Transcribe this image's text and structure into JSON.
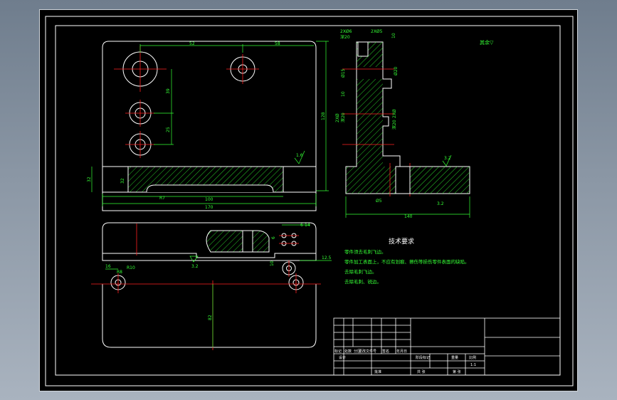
{
  "theme": {
    "background": "#000000",
    "outline": "#ffffff",
    "dimension": "#33ff33",
    "centerline": "#ff2020",
    "hatch": "#33ff33"
  },
  "top_view": {
    "dims": {
      "d52": "52",
      "d58": "58",
      "d39": "39",
      "d25": "25",
      "d128": "128",
      "d10": "10"
    },
    "roughness": "1.6"
  },
  "front_section": {
    "dims": {
      "d32a": "32",
      "d32b": "32",
      "d100": "100",
      "d170": "170",
      "r": "R7"
    }
  },
  "side_view": {
    "dims": {
      "top1": "2XØ6",
      "top2": "深20",
      "top3": "2XØ5",
      "top4": "10",
      "d15": "Ø15",
      "d20": "Ø20",
      "l2x": "2XØ",
      "l2x_2": "深20",
      "d10": "10",
      "r2x": "2XØ",
      "r2x_2": "深20",
      "s32": "3.2",
      "s32b": "3.2",
      "d5": "Ø5",
      "d140": "140"
    },
    "other_note": "其余▽"
  },
  "bottom_view": {
    "dims": {
      "d16": "16",
      "r10": "R10",
      "r8": "R8",
      "d82": "82",
      "s32": "3.2",
      "d10": "10",
      "d125": "12.5",
      "d6": "6",
      "d6b": "6",
      "d14": "14"
    }
  },
  "tech": {
    "title": "技术要求",
    "lines": [
      "零件须去毛刺飞边。",
      "零件加工表面上，不应有划痕、擦伤等损伤零件表面的缺陷。",
      "去除毛刺飞边。",
      "去除毛刺、锐边。"
    ]
  },
  "title_block": {
    "rev_mark": "标记",
    "rev_count": "处数",
    "rev_zone": "分区",
    "rev_doc": "更改文件号",
    "rev_sign": "签名",
    "rev_date": "年月日",
    "design": "设计",
    "approve": "批准",
    "stage": "阶段标记",
    "weight": "重量",
    "scale_label": "比例",
    "scale": "1:1",
    "sheet": "共 张",
    "sheet2": "第 张"
  }
}
